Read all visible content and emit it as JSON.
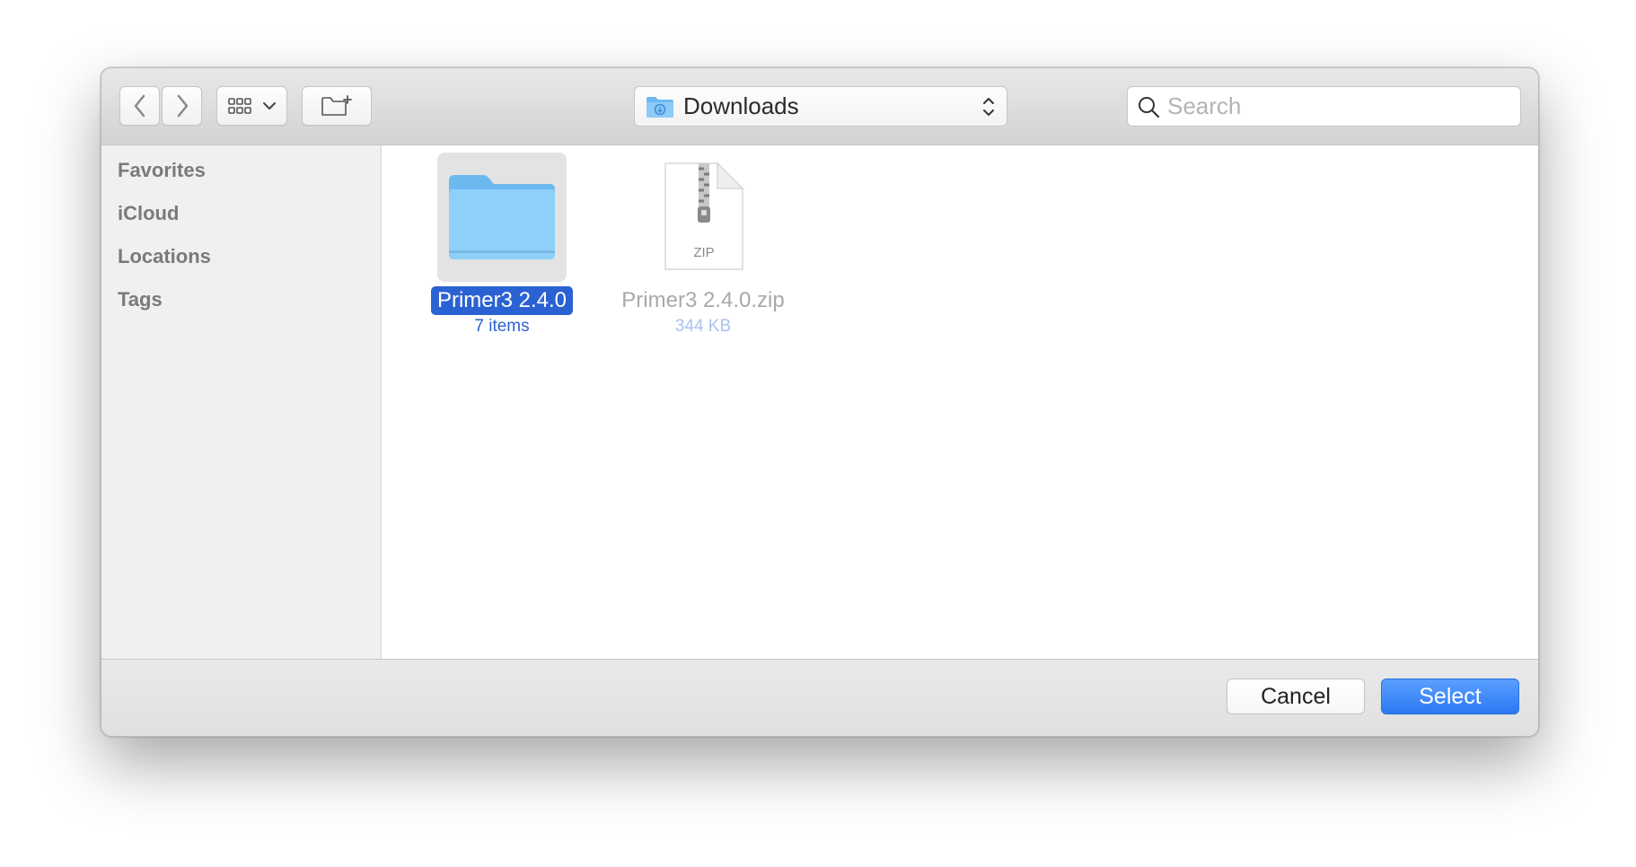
{
  "toolbar": {
    "path": {
      "label": "Downloads"
    },
    "search": {
      "placeholder": "Search",
      "value": ""
    }
  },
  "sidebar": {
    "items": [
      {
        "label": "Favorites"
      },
      {
        "label": "iCloud"
      },
      {
        "label": "Locations"
      },
      {
        "label": "Tags"
      }
    ]
  },
  "files": [
    {
      "name": "Primer3 2.4.0",
      "meta": "7 items",
      "kind": "folder",
      "selected": true
    },
    {
      "name": "Primer3 2.4.0.zip",
      "meta": "344 KB",
      "kind": "zip",
      "selected": false,
      "badge": "ZIP"
    }
  ],
  "footer": {
    "cancel_label": "Cancel",
    "select_label": "Select"
  },
  "colors": {
    "accent": "#2b62d3",
    "primary_button": "#2d78f4",
    "folder": "#7cc4f6"
  }
}
